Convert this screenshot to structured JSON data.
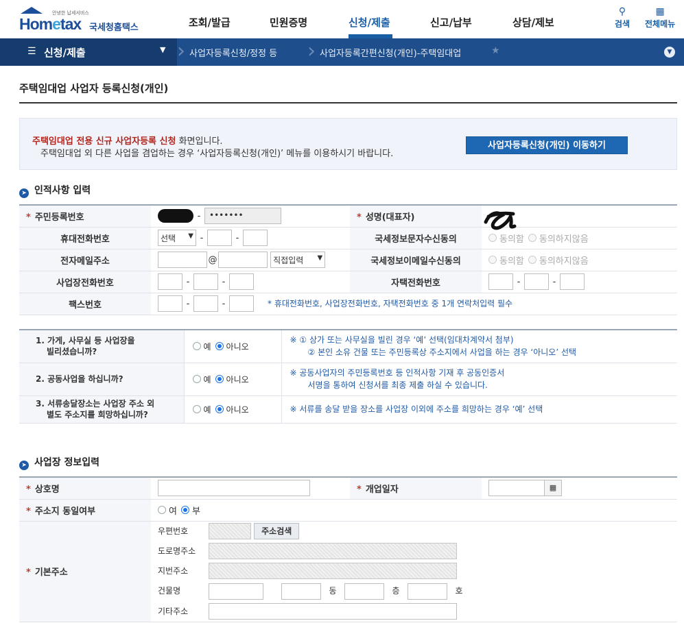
{
  "header": {
    "logo_small": "안녕한 납세서비스",
    "logo_brand_a": "Hom",
    "logo_brand_b": "e",
    "logo_brand_c": "tax",
    "logo_kor": "국세청홈택스",
    "menu": [
      "조회/발급",
      "민원증명",
      "신청/제출",
      "신고/납부",
      "상담/제보"
    ],
    "active": "신청/제출",
    "search": "검색",
    "allmenu": "전체메뉴"
  },
  "nav": {
    "first": "신청/제출",
    "crumb1": "사업자등록신청/정정 등",
    "crumb2": "사업자등록간편신청(개인)-주택임대업"
  },
  "page_title": "주택임대업 사업자 등록신청(개인)",
  "notice": {
    "highlight": "주택임대업 전용 신규 사업자등록 신청",
    "line1_rest": " 화면입니다.",
    "line2": "주택임대업 외 다른 사업을 겸업하는 경우 ‘사업자등록신청(개인)’ 메뉴를 이용하시기 바랍니다.",
    "button": "사업자등록신청(개인) 이동하기"
  },
  "personal": {
    "section": "인적사항 입력",
    "rrn": "주민등록번호",
    "rrn_back": "•••••••",
    "name": "성명(대표자)",
    "mobile": "휴대전화번호",
    "select_default": "선택",
    "sms_consent": "국세정보문자수신동의",
    "email": "전자메일주소",
    "at": "@",
    "direct_input": "직접입력",
    "email_consent": "국세정보이메일수신동의",
    "agree": "동의함",
    "disagree": "동의하지않음",
    "biz_phone": "사업장전화번호",
    "home_phone": "자택전화번호",
    "fax": "팩스번호",
    "contact_note": "* 휴대전화번호, 사업장전화번호, 자택전화번호 중 1개 연락처입력 필수"
  },
  "questions": [
    {
      "q1": "1. 가게, 사무실 등 사업장을",
      "q2": "빌리셨습니까?",
      "yes": "예",
      "no": "아니오",
      "n1": "※ ① 상가 또는 사무실을 빌린 경우 ‘예’ 선택(임대차계약서 첨부)",
      "n2": "② 본인 소유 건물 또는 주민등록상 주소지에서 사업을 하는 경우 ‘아니오’ 선택"
    },
    {
      "q1": "2. 공동사업을 하십니까?",
      "q2": "",
      "yes": "예",
      "no": "아니오",
      "n1": "※ 공동사업자의 주민등록번호 등 인적사항 기재 후 공동인증서",
      "n2": "서명을 통하여 신청서를 최종 제출 하실 수 있습니다."
    },
    {
      "q1": "3. 서류송달장소는 사업장 주소 외",
      "q2": "별도 주소지를 희망하십니까?",
      "yes": "예",
      "no": "아니오",
      "n1": "※ 서류를 송달 받을 장소를 사업장 이외에 주소를 희망하는 경우 ‘예’ 선택",
      "n2": ""
    }
  ],
  "business": {
    "section": "사업장 정보입력",
    "trade_name": "상호명",
    "open_date": "개업일자",
    "same_addr": "주소지 동일여부",
    "yeo": "여",
    "bu": "부",
    "basic_addr": "기본주소",
    "zip": "우편번호",
    "addr_search": "주소검색",
    "road": "도로명주소",
    "lot": "지번주소",
    "building": "건물명",
    "dong": "동",
    "floor": "층",
    "ho": "호",
    "etc": "기타주소"
  },
  "colors": {
    "brand": "#1d4e99",
    "nav": "#1f4e8c",
    "accent": "#1d67b3",
    "required": "#c23b2e"
  }
}
